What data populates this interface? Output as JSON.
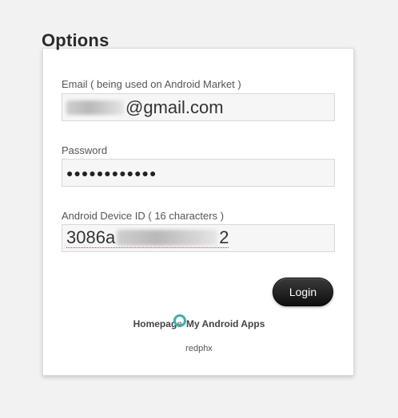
{
  "page": {
    "title": "Options"
  },
  "form": {
    "email": {
      "label": "Email ( being used on Android Market )",
      "value_visible": "@gmail.com"
    },
    "password": {
      "label": "Password",
      "value_masked": "●●●●●●●●●●●●"
    },
    "device_id": {
      "label": "Android Device ID ( 16 characters )",
      "value_prefix": "3086a",
      "value_suffix": "2"
    }
  },
  "actions": {
    "login_label": "Login"
  },
  "footer": {
    "homepage_label": "Homepage",
    "separator": " | ",
    "my_apps_label": "My Android Apps",
    "author": "redphx"
  },
  "colors": {
    "background": "#f2f2f2",
    "card": "#ffffff",
    "field_bg": "#f6f6f6",
    "button": "#111111",
    "cursor_ring": "#3fb0a8"
  }
}
